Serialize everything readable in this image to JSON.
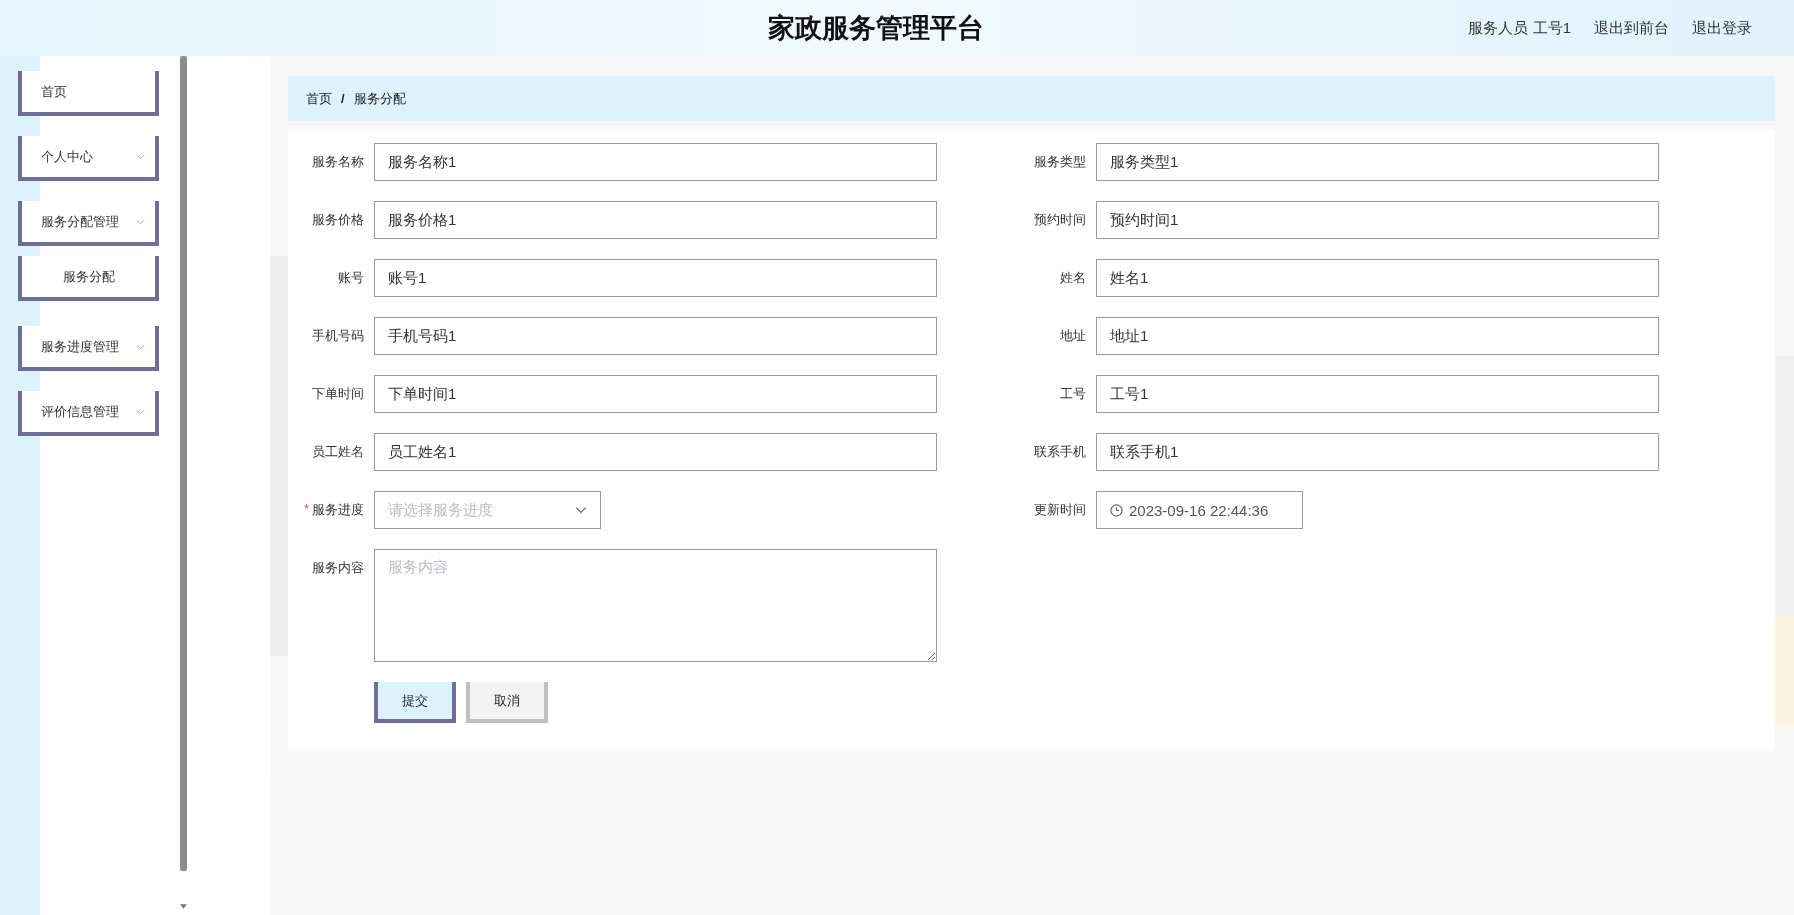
{
  "header": {
    "title": "家政服务管理平台",
    "user": "服务人员 工号1",
    "links": [
      "退出到前台",
      "退出登录"
    ]
  },
  "sidebar": {
    "items": [
      {
        "label": "首页",
        "kind": "link"
      },
      {
        "label": "个人中心",
        "kind": "group"
      },
      {
        "label": "服务分配管理",
        "kind": "group",
        "children": [
          {
            "label": "服务分配",
            "kind": "sub"
          }
        ]
      },
      {
        "label": "服务进度管理",
        "kind": "group"
      },
      {
        "label": "评价信息管理",
        "kind": "group"
      }
    ]
  },
  "breadcrumb": [
    "首页",
    "服务分配"
  ],
  "breadcrumb_separator": "/",
  "form": {
    "fields": [
      {
        "label": "服务名称",
        "kind": "text",
        "value": "服务名称1",
        "required": false
      },
      {
        "label": "服务类型",
        "kind": "text",
        "value": "服务类型1",
        "required": false
      },
      {
        "label": "服务价格",
        "kind": "text",
        "value": "服务价格1",
        "required": false
      },
      {
        "label": "预约时间",
        "kind": "text",
        "value": "预约时间1",
        "required": false
      },
      {
        "label": "账号",
        "kind": "text",
        "value": "账号1",
        "required": false
      },
      {
        "label": "姓名",
        "kind": "text",
        "value": "姓名1",
        "required": false
      },
      {
        "label": "手机号码",
        "kind": "text",
        "value": "手机号码1",
        "required": false
      },
      {
        "label": "地址",
        "kind": "text",
        "value": "地址1",
        "required": false
      },
      {
        "label": "下单时间",
        "kind": "text",
        "value": "下单时间1",
        "required": false
      },
      {
        "label": "工号",
        "kind": "text",
        "value": "工号1",
        "required": false
      },
      {
        "label": "员工姓名",
        "kind": "text",
        "value": "员工姓名1",
        "required": false
      },
      {
        "label": "联系手机",
        "kind": "text",
        "value": "联系手机1",
        "required": false
      },
      {
        "label": "服务进度",
        "kind": "select",
        "placeholder": "请选择服务进度",
        "required": true
      },
      {
        "label": "更新时间",
        "kind": "datetime",
        "value": "2023-09-16 22:44:36",
        "required": false
      },
      {
        "label": "服务内容",
        "kind": "textarea",
        "placeholder": "服务内容",
        "required": false
      }
    ],
    "required_mark": "*",
    "buttons": [
      {
        "label": "提交",
        "kind": "primary"
      },
      {
        "label": "取消",
        "kind": "default"
      }
    ]
  }
}
